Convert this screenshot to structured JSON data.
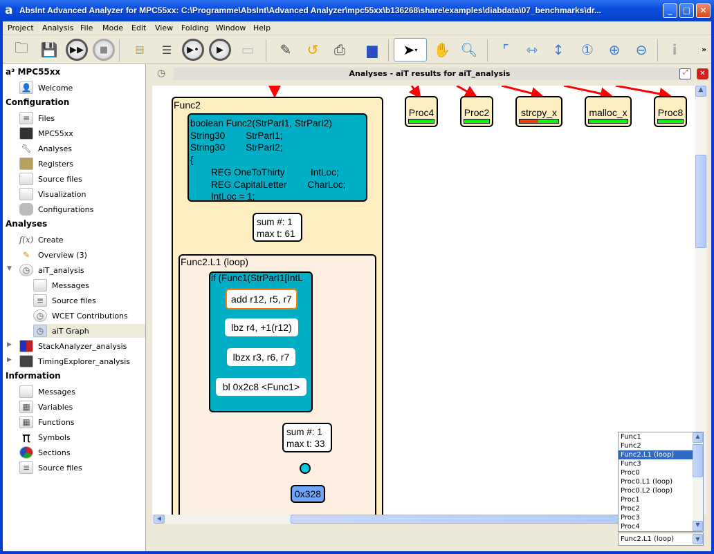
{
  "window": {
    "title": "AbsInt Advanced Analyzer for MPC55xx: C:\\Programme\\AbsInt\\Advanced Analyzer\\mpc55xx\\b136268\\share\\examples\\diabdata\\07_benchmarks\\dr...",
    "app_icon": "a3-logo"
  },
  "menu": [
    "Project",
    "Analysis",
    "File",
    "Mode",
    "Edit",
    "View",
    "Folding",
    "Window",
    "Help"
  ],
  "toolbar": {
    "overflow": "»",
    "icons": [
      "open-icon",
      "save-icon",
      "run-all-icon",
      "stop-icon",
      "graph-icon",
      "list-icon",
      "step-icon",
      "play-icon",
      "presentation-icon",
      "edit-save-icon",
      "undo-icon",
      "print-icon",
      "book-icon",
      "pointer-icon",
      "hand-icon",
      "search-icon",
      "layout-icon",
      "layout-horizontal-icon",
      "layout-vertical-icon",
      "zoom-reset-icon",
      "zoom-in-icon",
      "zoom-out-icon",
      "info-icon"
    ]
  },
  "sidebar": {
    "root": "a³ MPC55xx",
    "welcome": "Welcome",
    "configuration": {
      "heading": "Configuration",
      "items": [
        "Files",
        "MPC55xx",
        "Analyses",
        "Registers",
        "Source files",
        "Visualization",
        "Configurations"
      ]
    },
    "analyses": {
      "heading": "Analyses",
      "create": "Create",
      "overview": "Overview (3)",
      "ait": "aiT_analysis",
      "ait_children": [
        "Messages",
        "Source files",
        "WCET Contributions",
        "aiT Graph"
      ],
      "stack": "StackAnalyzer_analysis",
      "timing": "TimingExplorer_analysis"
    },
    "information": {
      "heading": "Information",
      "items": [
        "Messages",
        "Variables",
        "Functions",
        "Symbols",
        "Sections",
        "Source files"
      ]
    },
    "selected": "aiT Graph"
  },
  "panel": {
    "title": "Analyses - aiT results for aiT_analysis"
  },
  "graph": {
    "func2": {
      "label": "Func2",
      "code": [
        "boolean Func2(StrParI1, StrParI2)",
        "String30        StrParI1;",
        "String30        StrParI2;",
        "{",
        "        REG OneToThirty          IntLoc;",
        "        REG CapitalLetter        CharLoc;",
        "        IntLoc = 1;"
      ],
      "sum": "sum #: 1",
      "maxt": "max t: 61"
    },
    "loop": {
      "label": "Func2.L1 (loop)",
      "block_title": "if (Func1(StrParI1[IntL",
      "instructions": [
        "add r12, r5, r7",
        "lbz r4, +1(r12)",
        "lbzx r3, r6, r7",
        "bl 0x2c8 <Func1>"
      ],
      "sum": "sum #: 1",
      "maxt": "max t: 33",
      "address": "0x328"
    },
    "procs": [
      {
        "name": "Proc4",
        "red": 0
      },
      {
        "name": "Proc2",
        "red": 0
      },
      {
        "name": "strcpy_x",
        "red": 0.47
      },
      {
        "name": "malloc_x",
        "red": 0.02
      },
      {
        "name": "Proc8",
        "red": 0.02
      }
    ],
    "colors": {
      "block": "#00aec6",
      "container": "#fdefc0",
      "loop": "#fdefe2",
      "edge": "#ff0000",
      "back_edge": "#000080",
      "highlight": "#ff8000"
    }
  },
  "dropdown": {
    "options": [
      "Func1",
      "Func2",
      "Func2.L1 (loop)",
      "Func3",
      "Proc0",
      "Proc0.L1 (loop)",
      "Proc0.L2 (loop)",
      "Proc1",
      "Proc2",
      "Proc3",
      "Proc4"
    ],
    "selected": "Func2.L1 (loop)"
  }
}
